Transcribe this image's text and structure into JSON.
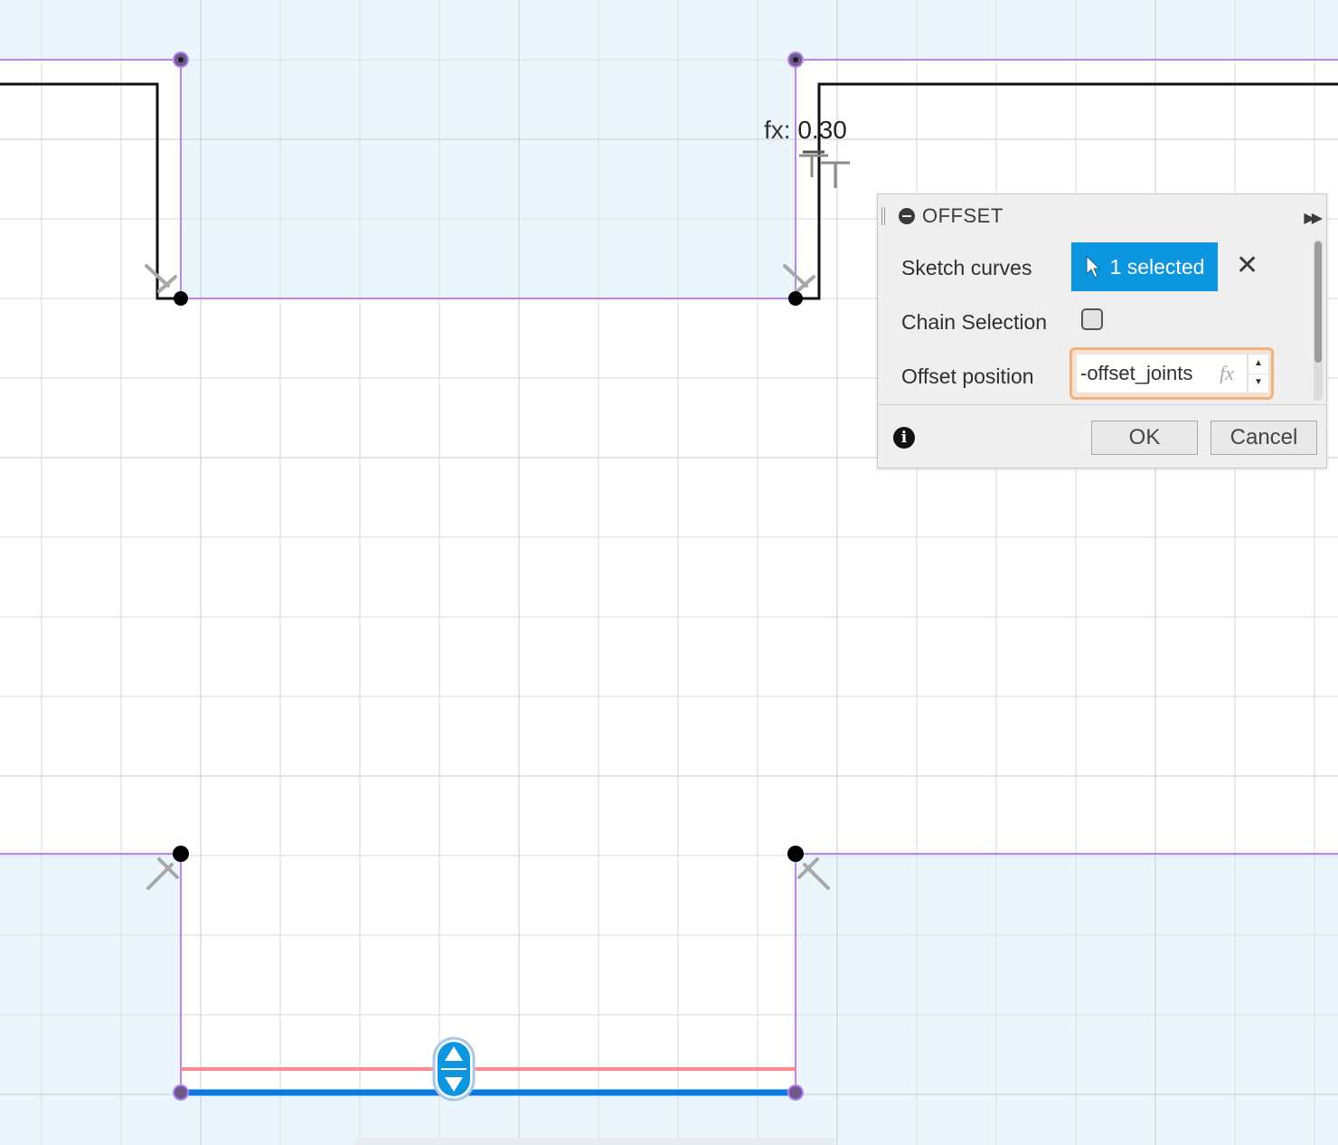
{
  "viewport": {
    "dimension_label_prefix": "fx:",
    "dimension_label_value": "0.30"
  },
  "dialog": {
    "title": "OFFSET",
    "rows": {
      "sketch_curves_label": "Sketch curves",
      "selection_button_label": "1 selected",
      "chain_selection_label": "Chain Selection",
      "chain_selection_checked": false,
      "offset_position_label": "Offset position",
      "offset_position_value": "-offset_joints",
      "fx_label": "fx"
    },
    "buttons": {
      "ok_label": "OK",
      "cancel_label": "Cancel"
    },
    "icons": {
      "collapse": "minus-circle-icon",
      "expand": "fast-forward-icon",
      "selection": "cursor-icon",
      "clear": "close-icon",
      "info": "info-icon"
    }
  },
  "colors": {
    "grid_background": "#eaf6fc",
    "grid_line": "#d8e1e6",
    "sketch_profile": "#b985f5",
    "existing_line": "#111111",
    "offset_preview": "#ff7b84",
    "selected_line": "#0a7ae0",
    "accent": "#0d96e0",
    "input_focus": "#f2b27d"
  }
}
